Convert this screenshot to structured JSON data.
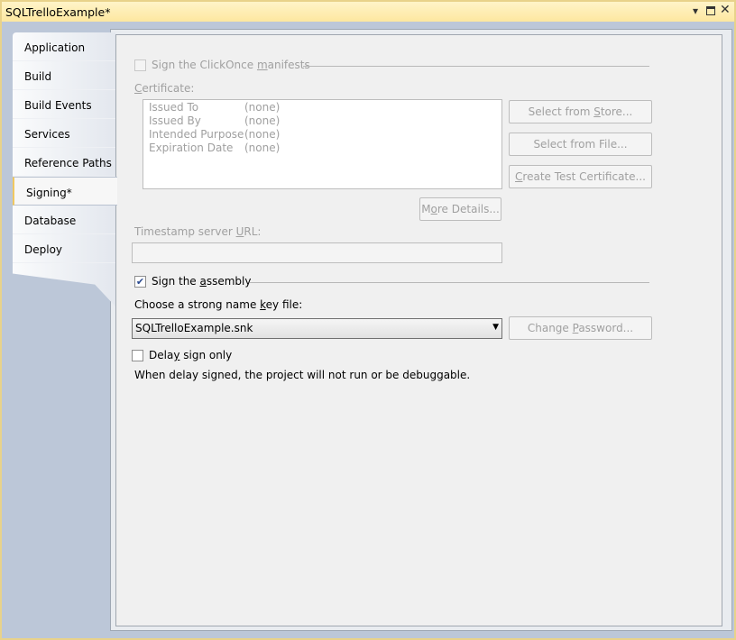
{
  "window": {
    "title": "SQLTrelloExample*"
  },
  "tabs": [
    {
      "label": "Application"
    },
    {
      "label": "Build"
    },
    {
      "label": "Build Events"
    },
    {
      "label": "Services"
    },
    {
      "label": "Reference Paths"
    },
    {
      "label": "Signing*",
      "active": true
    },
    {
      "label": "Database"
    },
    {
      "label": "Deploy"
    }
  ],
  "signing": {
    "clickonce_label": "Sign the ClickOnce manifests",
    "clickonce_checked": false,
    "certificate_label": "Certificate:",
    "cert_fields": [
      {
        "name": "Issued To",
        "value": "(none)"
      },
      {
        "name": "Issued By",
        "value": "(none)"
      },
      {
        "name": "Intended Purpose",
        "value": "(none)"
      },
      {
        "name": "Expiration Date",
        "value": "(none)"
      }
    ],
    "select_store": "Select from Store...",
    "select_file": "Select from File...",
    "create_test": "Create Test Certificate...",
    "more_details": "More Details...",
    "timestamp_label": "Timestamp server URL:",
    "timestamp_value": "",
    "sign_assembly_label": "Sign the assembly",
    "sign_assembly_checked": true,
    "key_file_label": "Choose a strong name key file:",
    "key_file_value": "SQLTrelloExample.snk",
    "change_password": "Change Password...",
    "delay_sign_label": "Delay sign only",
    "delay_sign_checked": false,
    "delay_note": "When delay signed, the project will not run or be debuggable."
  }
}
